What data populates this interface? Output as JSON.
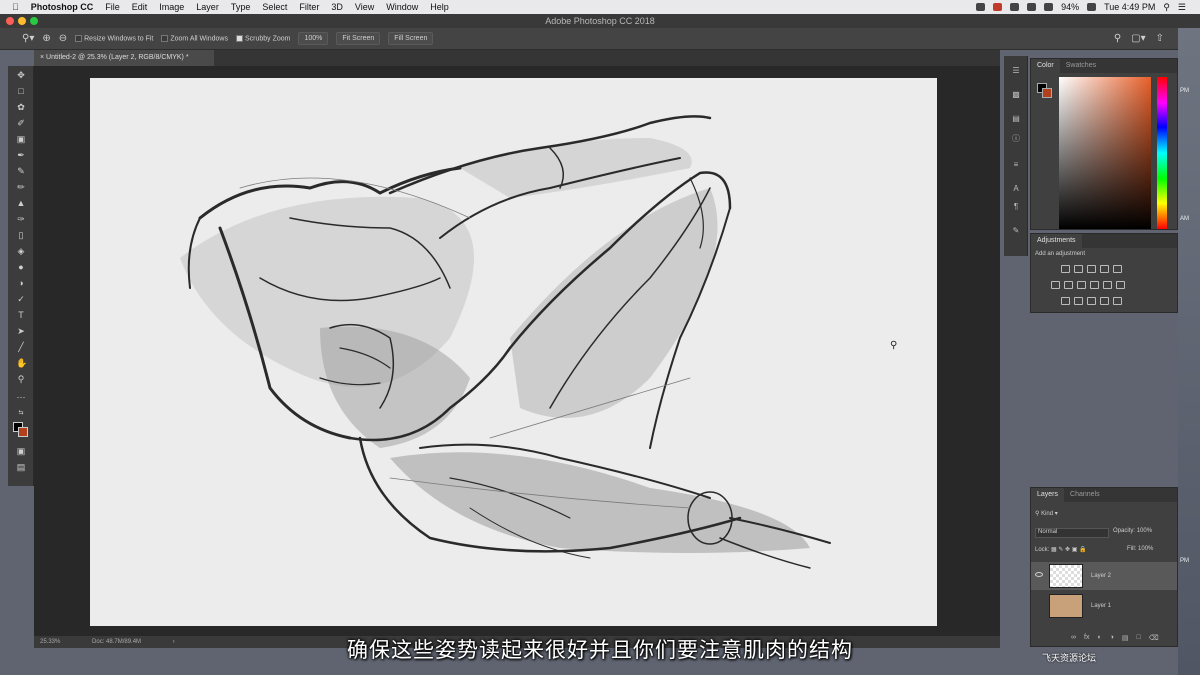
{
  "menubar": {
    "app_name": "Photoshop CC",
    "items": [
      "File",
      "Edit",
      "Image",
      "Layer",
      "Type",
      "Select",
      "Filter",
      "3D",
      "View",
      "Window",
      "Help"
    ],
    "battery": "94%",
    "clock": "Tue 4:49 PM"
  },
  "window": {
    "title": "Adobe Photoshop CC 2018"
  },
  "options_bar": {
    "resize_windows_label": "Resize Windows to Fit",
    "zoom_all_label": "Zoom All Windows",
    "scrubby_zoom_label": "Scrubby Zoom",
    "scrubby_zoom_checked": true,
    "btn_100": "100%",
    "btn_fit": "Fit Screen",
    "btn_fill": "Fill Screen"
  },
  "document": {
    "tab_title": "Untitled-2 @ 25.3% (Layer 2, RGB/8/CMYK) *"
  },
  "status": {
    "zoom": "25.33%",
    "doc_size": "Doc: 48.7M/89.4M"
  },
  "subtitle": "确保这些姿势读起来很好并且你们要注意肌肉的结构",
  "color_panel": {
    "tabs": [
      "Color",
      "Swatches"
    ],
    "foreground": "#000000",
    "background": "#b3401c"
  },
  "adjustments_panel": {
    "tab": "Adjustments",
    "hint": "Add an adjustment"
  },
  "layers_panel": {
    "tabs": [
      "Layers",
      "Channels"
    ],
    "kind_label": "Kind",
    "blend_mode": "Normal",
    "opacity_label": "Opacity:",
    "opacity": "100%",
    "lock_label": "Lock:",
    "fill_label": "Fill:",
    "fill": "100%",
    "layers": [
      {
        "name": "Layer 2",
        "selected": true
      },
      {
        "name": "Layer 1",
        "selected": false
      }
    ]
  },
  "watermark": "飞天资源论坛"
}
